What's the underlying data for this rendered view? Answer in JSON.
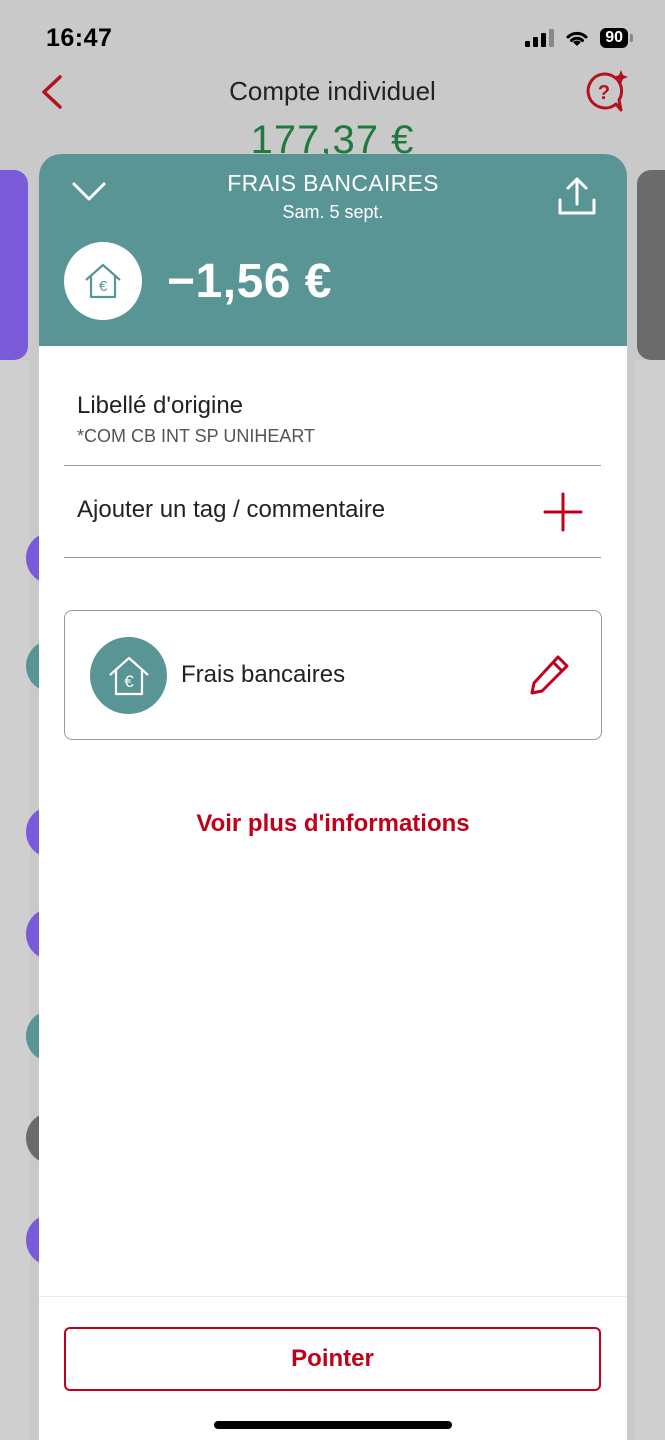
{
  "status_bar": {
    "time": "16:47",
    "battery": "90"
  },
  "background": {
    "title": "Compte individuel",
    "balance": "177,37 €"
  },
  "sheet": {
    "title": "FRAIS BANCAIRES",
    "date": "Sam. 5 sept.",
    "amount": "−1,56 €",
    "original_label_title": "Libellé d'origine",
    "original_label_value": "*COM CB INT SP UNIHEART",
    "add_tag_label": "Ajouter un tag / commentaire",
    "category_label": "Frais bancaires",
    "more_info_link": "Voir plus d'informations",
    "pointer_button": "Pointer"
  },
  "colors": {
    "header_teal": "#5a9595",
    "accent_red": "#c0001a",
    "balance_green": "#1f7a3d"
  },
  "icons": {
    "back": "chevron-left-icon",
    "help": "help-chat-icon",
    "close": "chevron-down-icon",
    "share": "share-icon",
    "category": "house-euro-icon",
    "add": "plus-icon",
    "edit": "pencil-icon"
  }
}
